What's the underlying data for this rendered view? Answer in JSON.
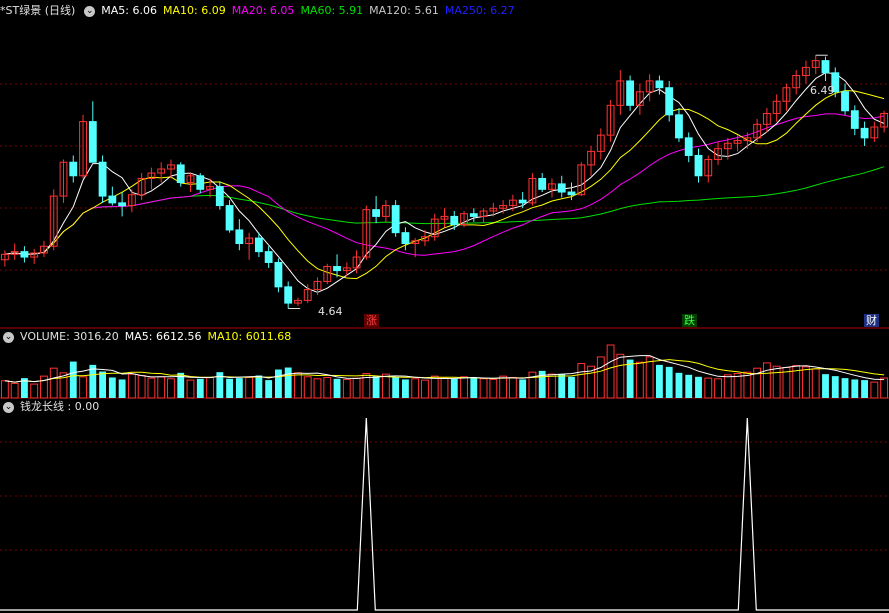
{
  "main_header": {
    "title": "*ST绿景 (日线)",
    "ma5": "MA5: 6.06",
    "ma10": "MA10: 6.09",
    "ma20": "MA20: 6.05",
    "ma60": "MA60: 5.91",
    "ma120": "MA120: 5.61",
    "ma250": "MA250: 6.27"
  },
  "volume_header": {
    "title": "VOLUME: 3016.20",
    "ma5": "MA5: 6612.56",
    "ma10": "MA10: 6011.68"
  },
  "indicator_header": {
    "title": "钱龙长线 : 0.00"
  },
  "annotations": {
    "high_label": "6.49",
    "low_label": "4.64",
    "marker_zhang": "涨",
    "marker_die": "跌",
    "marker_cai": "财"
  },
  "colors": {
    "up": "#ff3232",
    "down": "#54ffff",
    "ma5": "#ffffff",
    "ma10": "#ffff00",
    "ma20": "#ff00ff",
    "ma60": "#00e000",
    "ma120": "#c8c8c8",
    "ma250": "#2020ff",
    "grid": "#7a0000"
  },
  "chart_data": [
    {
      "type": "candlestick",
      "title": "*ST绿景 (日线)",
      "candles": [
        [
          4.98,
          5.05,
          4.93,
          5.02
        ],
        [
          5.02,
          5.1,
          4.98,
          5.04
        ],
        [
          5.04,
          5.08,
          4.96,
          5.0
        ],
        [
          5.0,
          5.06,
          4.95,
          5.03
        ],
        [
          5.03,
          5.12,
          5.0,
          5.08
        ],
        [
          5.08,
          5.5,
          5.05,
          5.45
        ],
        [
          5.45,
          5.72,
          5.4,
          5.7
        ],
        [
          5.7,
          5.75,
          5.55,
          5.6
        ],
        [
          5.6,
          6.05,
          5.58,
          6.0
        ],
        [
          6.0,
          6.15,
          5.85,
          5.7
        ],
        [
          5.7,
          5.75,
          5.4,
          5.45
        ],
        [
          5.45,
          5.52,
          5.38,
          5.4
        ],
        [
          5.4,
          5.48,
          5.3,
          5.38
        ],
        [
          5.38,
          5.5,
          5.33,
          5.46
        ],
        [
          5.46,
          5.62,
          5.42,
          5.58
        ],
        [
          5.58,
          5.66,
          5.5,
          5.62
        ],
        [
          5.62,
          5.7,
          5.55,
          5.65
        ],
        [
          5.65,
          5.72,
          5.58,
          5.68
        ],
        [
          5.68,
          5.7,
          5.52,
          5.55
        ],
        [
          5.55,
          5.62,
          5.48,
          5.6
        ],
        [
          5.6,
          5.62,
          5.47,
          5.5
        ],
        [
          5.5,
          5.58,
          5.44,
          5.52
        ],
        [
          5.52,
          5.56,
          5.35,
          5.38
        ],
        [
          5.38,
          5.42,
          5.18,
          5.2
        ],
        [
          5.2,
          5.28,
          5.05,
          5.1
        ],
        [
          5.1,
          5.18,
          4.98,
          5.14
        ],
        [
          5.14,
          5.18,
          5.0,
          5.04
        ],
        [
          5.04,
          5.08,
          4.92,
          4.96
        ],
        [
          4.96,
          4.99,
          4.74,
          4.78
        ],
        [
          4.78,
          4.82,
          4.62,
          4.66
        ],
        [
          4.66,
          4.7,
          4.64,
          4.68
        ],
        [
          4.68,
          4.8,
          4.66,
          4.76
        ],
        [
          4.76,
          4.85,
          4.72,
          4.82
        ],
        [
          4.82,
          4.95,
          4.8,
          4.93
        ],
        [
          4.93,
          5.02,
          4.85,
          4.9
        ],
        [
          4.9,
          4.96,
          4.86,
          4.92
        ],
        [
          4.92,
          5.05,
          4.88,
          5.0
        ],
        [
          5.0,
          5.38,
          4.98,
          5.35
        ],
        [
          5.35,
          5.45,
          5.25,
          5.3
        ],
        [
          5.3,
          5.42,
          5.26,
          5.38
        ],
        [
          5.38,
          5.42,
          5.15,
          5.18
        ],
        [
          5.18,
          5.22,
          5.05,
          5.1
        ],
        [
          5.1,
          5.14,
          5.0,
          5.12
        ],
        [
          5.12,
          5.2,
          5.08,
          5.15
        ],
        [
          5.15,
          5.32,
          5.12,
          5.28
        ],
        [
          5.28,
          5.36,
          5.22,
          5.3
        ],
        [
          5.3,
          5.34,
          5.2,
          5.24
        ],
        [
          5.24,
          5.34,
          5.22,
          5.32
        ],
        [
          5.32,
          5.36,
          5.26,
          5.3
        ],
        [
          5.3,
          5.36,
          5.25,
          5.34
        ],
        [
          5.34,
          5.4,
          5.3,
          5.36
        ],
        [
          5.36,
          5.42,
          5.32,
          5.38
        ],
        [
          5.38,
          5.46,
          5.34,
          5.42
        ],
        [
          5.42,
          5.48,
          5.36,
          5.4
        ],
        [
          5.4,
          5.62,
          5.38,
          5.58
        ],
        [
          5.58,
          5.62,
          5.48,
          5.5
        ],
        [
          5.5,
          5.58,
          5.44,
          5.54
        ],
        [
          5.54,
          5.6,
          5.44,
          5.48
        ],
        [
          5.48,
          5.55,
          5.42,
          5.46
        ],
        [
          5.46,
          5.7,
          5.45,
          5.68
        ],
        [
          5.68,
          5.82,
          5.6,
          5.78
        ],
        [
          5.78,
          5.95,
          5.72,
          5.9
        ],
        [
          5.9,
          6.16,
          5.85,
          6.12
        ],
        [
          6.12,
          6.38,
          6.05,
          6.3
        ],
        [
          6.3,
          6.34,
          6.08,
          6.12
        ],
        [
          6.12,
          6.28,
          6.05,
          6.22
        ],
        [
          6.22,
          6.35,
          6.15,
          6.3
        ],
        [
          6.3,
          6.34,
          6.2,
          6.25
        ],
        [
          6.25,
          6.3,
          6.0,
          6.05
        ],
        [
          6.05,
          6.1,
          5.85,
          5.88
        ],
        [
          5.88,
          5.92,
          5.7,
          5.75
        ],
        [
          5.75,
          5.8,
          5.55,
          5.6
        ],
        [
          5.6,
          5.75,
          5.55,
          5.72
        ],
        [
          5.72,
          5.85,
          5.68,
          5.8
        ],
        [
          5.8,
          5.88,
          5.72,
          5.84
        ],
        [
          5.84,
          5.9,
          5.78,
          5.86
        ],
        [
          5.86,
          5.92,
          5.8,
          5.88
        ],
        [
          5.88,
          6.02,
          5.85,
          5.98
        ],
        [
          5.98,
          6.1,
          5.92,
          6.06
        ],
        [
          6.06,
          6.2,
          6.0,
          6.15
        ],
        [
          6.15,
          6.28,
          6.08,
          6.25
        ],
        [
          6.25,
          6.38,
          6.2,
          6.34
        ],
        [
          6.34,
          6.45,
          6.28,
          6.4
        ],
        [
          6.4,
          6.49,
          6.35,
          6.45
        ],
        [
          6.45,
          6.48,
          6.3,
          6.36
        ],
        [
          6.36,
          6.4,
          6.18,
          6.22
        ],
        [
          6.22,
          6.28,
          6.05,
          6.08
        ],
        [
          6.08,
          6.12,
          5.9,
          5.95
        ],
        [
          5.95,
          6.0,
          5.82,
          5.88
        ],
        [
          5.88,
          6.0,
          5.85,
          5.96
        ],
        [
          5.96,
          6.08,
          5.92,
          6.06
        ]
      ],
      "volume": {
        "values": [
          2600,
          2200,
          3000,
          2100,
          3300,
          4500,
          3800,
          5500,
          3200,
          5000,
          4000,
          3100,
          2800,
          3600,
          3400,
          3000,
          3200,
          2900,
          3800,
          2700,
          2900,
          3100,
          3900,
          2900,
          3000,
          3100,
          3400,
          2700,
          4300,
          4600,
          3800,
          3200,
          2900,
          3100,
          2900,
          2800,
          3000,
          3700,
          3300,
          3600,
          3100,
          2800,
          2900,
          2700,
          3300,
          3000,
          2900,
          3200,
          3100,
          2900,
          2800,
          3300,
          3100,
          2800,
          3900,
          4100,
          3600,
          3600,
          3200,
          5200,
          4800,
          6200,
          8000,
          6600,
          5800,
          5400,
          6200,
          5000,
          4700,
          3800,
          3500,
          3200,
          3000,
          2900,
          3500,
          3700,
          3900,
          4500,
          5300,
          4800,
          4600,
          4900,
          4700,
          4400,
          3600,
          3300,
          3000,
          2800,
          2700,
          2400,
          3016.2
        ],
        "ma5": 6612.56,
        "ma10": 6011.68
      },
      "indicator": {
        "name": "钱龙长线",
        "spikes_at_index": [
          37,
          76
        ],
        "value": 0.0
      },
      "y_range": [
        4.55,
        6.75
      ],
      "high": 6.49,
      "low": 4.64
    }
  ]
}
